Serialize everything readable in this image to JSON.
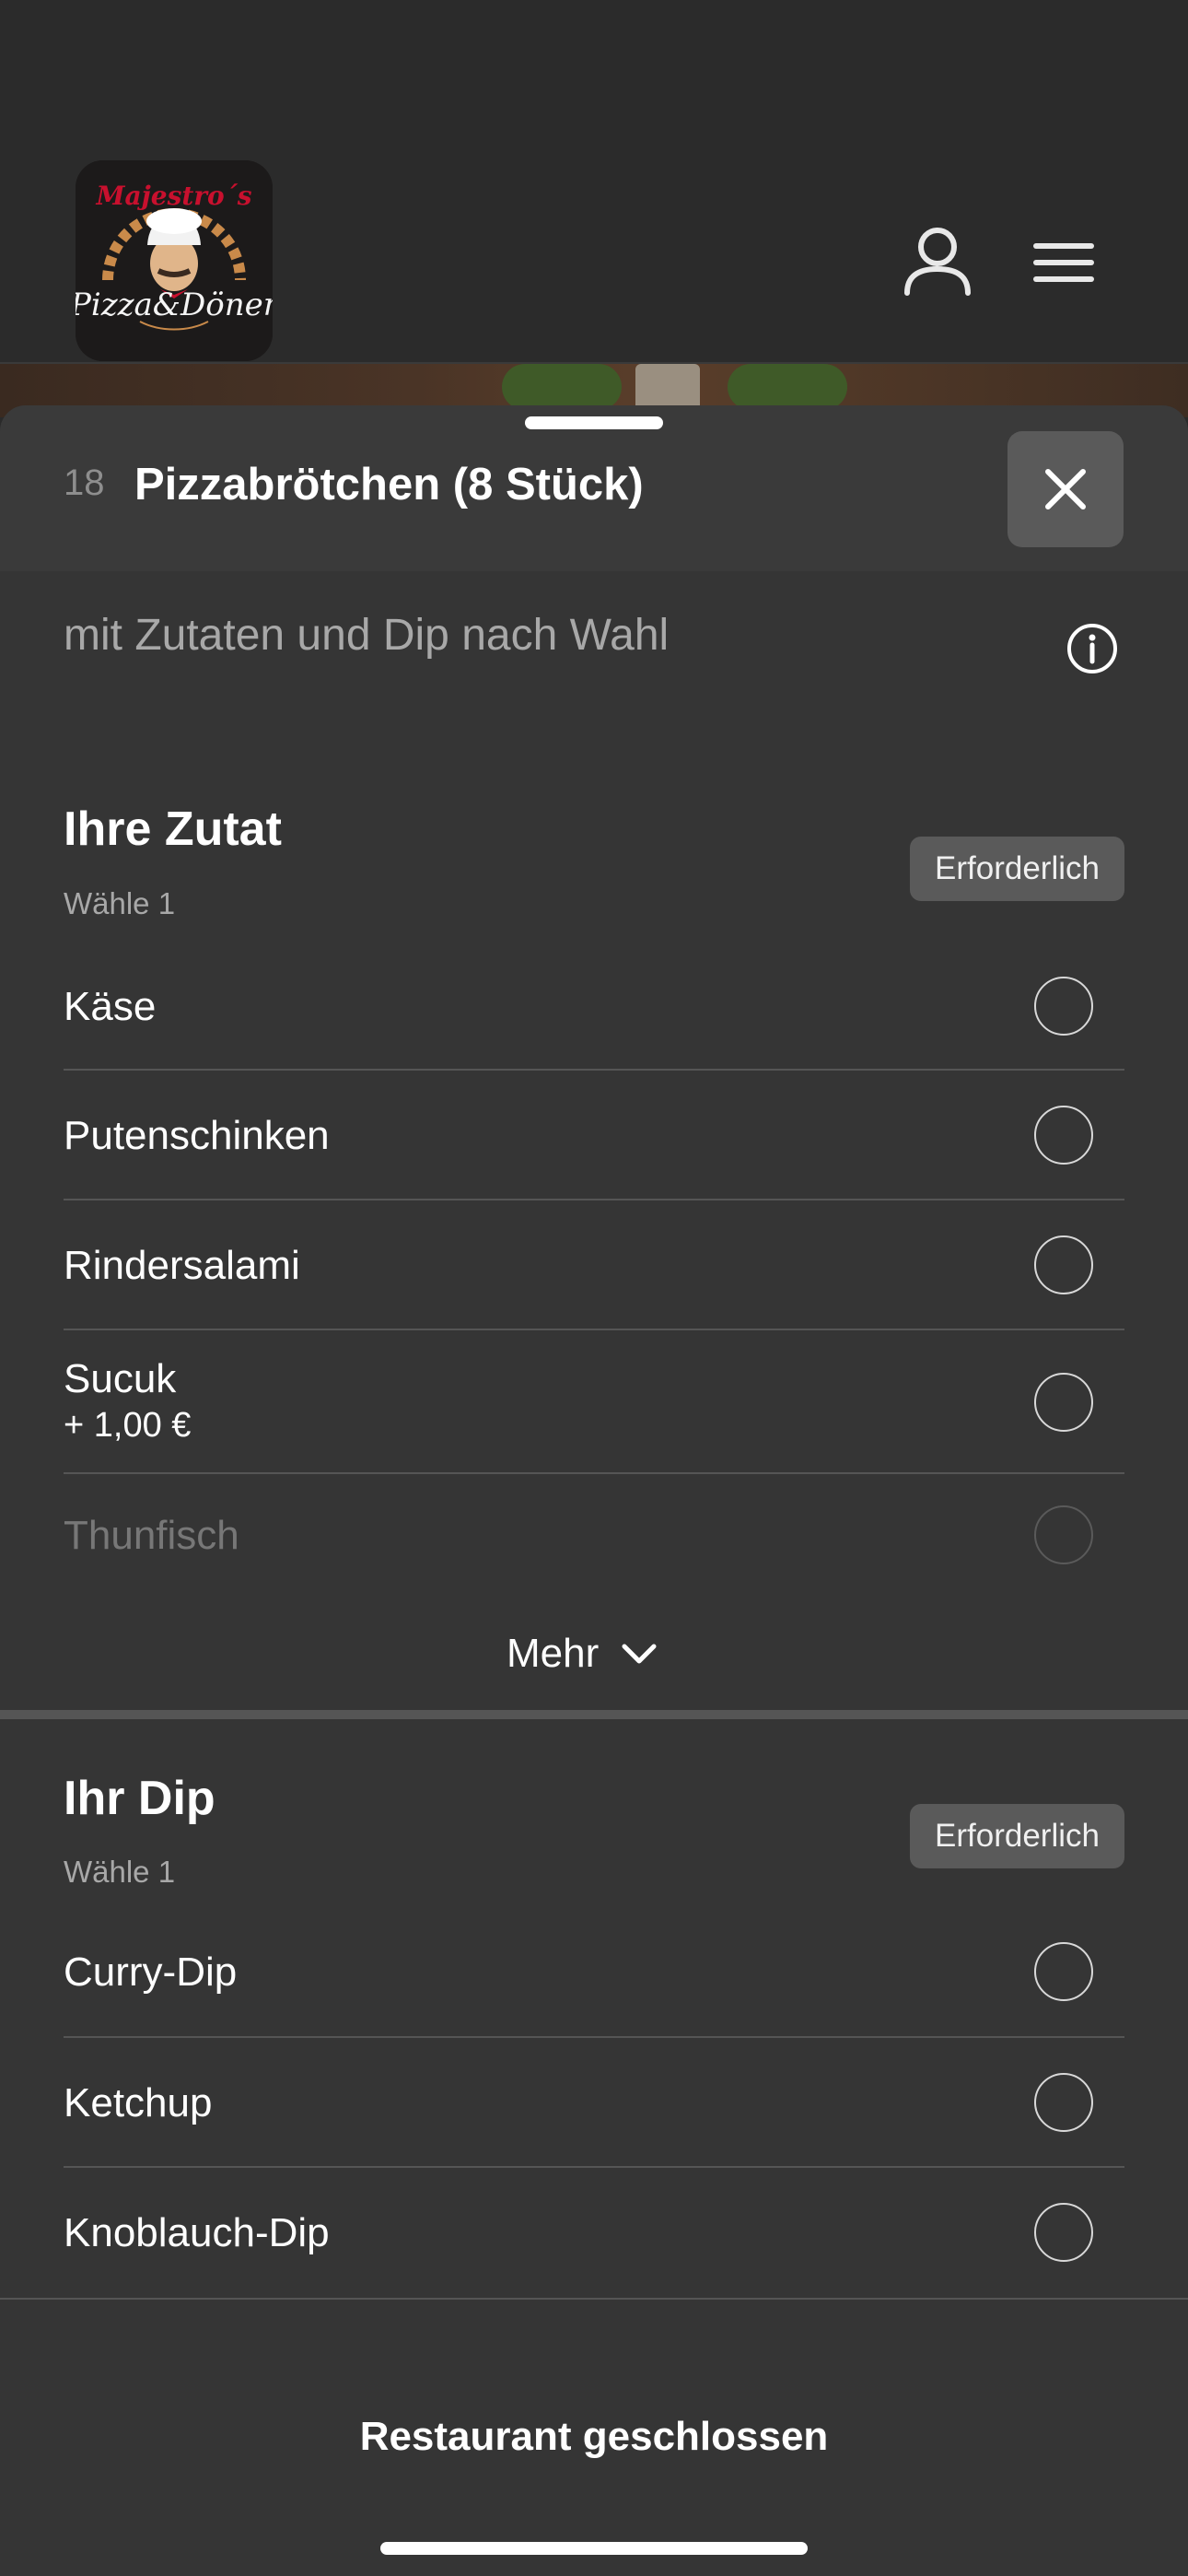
{
  "header": {
    "logo_alt": "Majestro's Pizza & Döner",
    "logo_top_text": "Majestro´s",
    "logo_bottom_text": "Pizza&Döner",
    "icons": {
      "account": "user-icon",
      "menu": "hamburger-menu-icon"
    }
  },
  "product": {
    "number": "18",
    "title": "Pizzabrötchen (8 Stück)",
    "description": "mit Zutaten und Dip nach Wahl"
  },
  "groups": [
    {
      "title": "Ihre Zutat",
      "subtitle": "Wähle 1",
      "badge": "Erforderlich",
      "options": [
        {
          "label": "Käse"
        },
        {
          "label": "Putenschinken"
        },
        {
          "label": "Rindersalami"
        },
        {
          "label": "Sucuk",
          "price": "+ 1,00 €"
        },
        {
          "label": "Thunfisch"
        }
      ],
      "more_label": "Mehr"
    },
    {
      "title": "Ihr Dip",
      "subtitle": "Wähle 1",
      "badge": "Erforderlich",
      "options": [
        {
          "label": "Curry-Dip"
        },
        {
          "label": "Ketchup"
        },
        {
          "label": "Knoblauch-Dip"
        }
      ]
    }
  ],
  "footer": {
    "status": "Restaurant geschlossen"
  },
  "colors": {
    "sheet_bg": "#353535",
    "header_bg": "#2b2b2b",
    "badge_bg": "#5a5a5a"
  }
}
